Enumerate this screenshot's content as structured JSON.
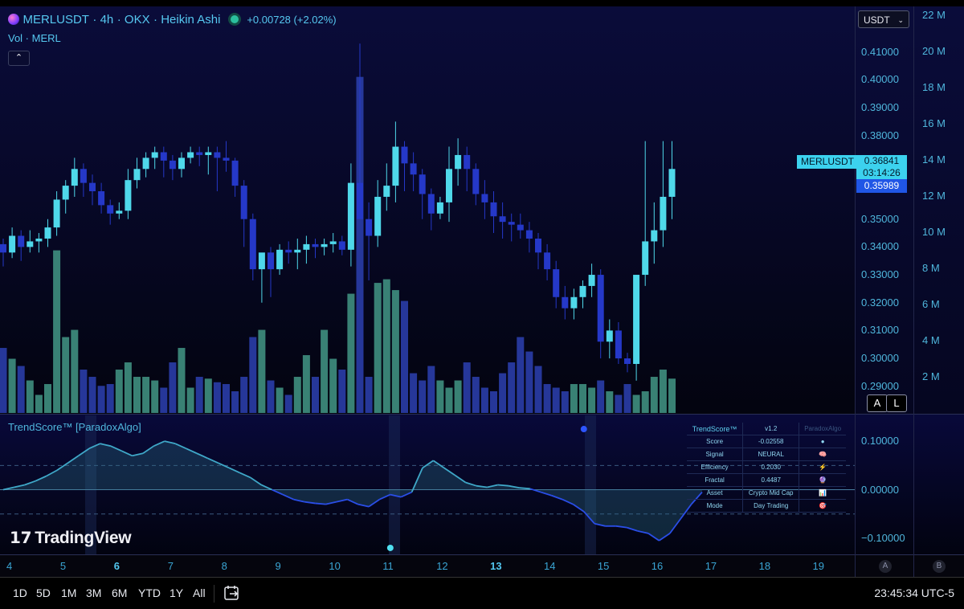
{
  "header": {
    "symbol": "MERLUSDT",
    "interval": "4h",
    "exchange": "OKX",
    "chart_style": "Heikin Ashi",
    "change": "+0.00728 (+2.02%)",
    "volume_label": "Vol · MERL",
    "currency": "USDT"
  },
  "price_axis": {
    "labels": [
      "0.41000",
      "0.40000",
      "0.39000",
      "0.38000",
      "0.35000",
      "0.34000",
      "0.33000",
      "0.32000",
      "0.31000",
      "0.30000",
      "0.29000"
    ],
    "current_symbol": "MERLUSDT",
    "current_price": "0.36841",
    "countdown": "03:14:26",
    "secondary_price": "0.35989",
    "auto_btn": "A",
    "log_btn": "L"
  },
  "volume_axis": {
    "labels": [
      "22 M",
      "20 M",
      "18 M",
      "16 M",
      "14 M",
      "12 M",
      "10 M",
      "8 M",
      "6 M",
      "4 M",
      "2 M"
    ]
  },
  "indicator": {
    "title": "TrendScore™ [ParadoxAlgo]",
    "axis_labels": [
      "0.10000",
      "0.00000",
      "−0.10000"
    ],
    "table": {
      "header": [
        "TrendScore™",
        "v1.2",
        "ParadoxAlgo"
      ],
      "rows": [
        {
          "label": "Score",
          "value": "-0.02558",
          "icon": "●"
        },
        {
          "label": "Signal",
          "value": "NEURAL",
          "icon": "🧠"
        },
        {
          "label": "Efficiency",
          "value": "0.2030",
          "icon": "⚡"
        },
        {
          "label": "Fractal",
          "value": "0.4487",
          "icon": "🔮"
        },
        {
          "label": "Asset",
          "value": "Crypto Mid Cap",
          "icon": "📊"
        },
        {
          "label": "Mode",
          "value": "Day Trading",
          "icon": "🎯"
        }
      ]
    }
  },
  "time_axis": {
    "labels": [
      "4",
      "5",
      "6",
      "7",
      "8",
      "9",
      "10",
      "11",
      "12",
      "13",
      "14",
      "15",
      "16",
      "17",
      "18",
      "19"
    ],
    "scale_a": "A",
    "scale_b": "B"
  },
  "brand": "TradingView",
  "bottom_bar": {
    "ranges": [
      "1D",
      "5D",
      "1M",
      "3M",
      "6M",
      "YTD",
      "1Y",
      "All"
    ],
    "clock": "23:45:34 UTC-5"
  },
  "colors": {
    "bull": "#4fd8ea",
    "bear": "#2538c8",
    "vol_bull": "#3f8f7f",
    "vol_bear": "#2a3da8",
    "text_accent": "#4fc3e8"
  },
  "chart_data": {
    "type": "candlestick",
    "style": "Heikin Ashi",
    "x_tick_labels": [
      "4",
      "5",
      "6",
      "7",
      "8",
      "9",
      "10",
      "11",
      "12",
      "13",
      "14",
      "15",
      "16",
      "17",
      "18",
      "19"
    ],
    "price_range": [
      0.283,
      0.42
    ],
    "volume_range_millions": [
      0,
      22.5
    ],
    "candles": [
      [
        0.341,
        0.343,
        0.333,
        0.338
      ],
      [
        0.338,
        0.347,
        0.336,
        0.344
      ],
      [
        0.344,
        0.346,
        0.335,
        0.34
      ],
      [
        0.34,
        0.346,
        0.338,
        0.342
      ],
      [
        0.342,
        0.345,
        0.338,
        0.343
      ],
      [
        0.343,
        0.35,
        0.34,
        0.347
      ],
      [
        0.347,
        0.36,
        0.344,
        0.357
      ],
      [
        0.357,
        0.364,
        0.352,
        0.362
      ],
      [
        0.362,
        0.372,
        0.358,
        0.368
      ],
      [
        0.368,
        0.37,
        0.358,
        0.363
      ],
      [
        0.363,
        0.366,
        0.355,
        0.36
      ],
      [
        0.36,
        0.363,
        0.352,
        0.355
      ],
      [
        0.355,
        0.357,
        0.348,
        0.352
      ],
      [
        0.352,
        0.356,
        0.35,
        0.353
      ],
      [
        0.353,
        0.368,
        0.35,
        0.364
      ],
      [
        0.364,
        0.372,
        0.361,
        0.368
      ],
      [
        0.368,
        0.374,
        0.365,
        0.372
      ],
      [
        0.372,
        0.376,
        0.368,
        0.374
      ],
      [
        0.374,
        0.376,
        0.365,
        0.371
      ],
      [
        0.371,
        0.373,
        0.364,
        0.368
      ],
      [
        0.368,
        0.374,
        0.365,
        0.372
      ],
      [
        0.372,
        0.376,
        0.37,
        0.374
      ],
      [
        0.374,
        0.376,
        0.369,
        0.373
      ],
      [
        0.373,
        0.376,
        0.366,
        0.374
      ],
      [
        0.374,
        0.376,
        0.36,
        0.372
      ],
      [
        0.372,
        0.378,
        0.367,
        0.371
      ],
      [
        0.371,
        0.372,
        0.358,
        0.362
      ],
      [
        0.362,
        0.364,
        0.34,
        0.35
      ],
      [
        0.35,
        0.352,
        0.328,
        0.332
      ],
      [
        0.332,
        0.334,
        0.32,
        0.338
      ],
      [
        0.338,
        0.34,
        0.322,
        0.332
      ],
      [
        0.332,
        0.341,
        0.33,
        0.339
      ],
      [
        0.339,
        0.342,
        0.334,
        0.338
      ],
      [
        0.338,
        0.343,
        0.332,
        0.339
      ],
      [
        0.339,
        0.344,
        0.334,
        0.341
      ],
      [
        0.341,
        0.343,
        0.336,
        0.34
      ],
      [
        0.34,
        0.343,
        0.337,
        0.341
      ],
      [
        0.341,
        0.345,
        0.338,
        0.342
      ],
      [
        0.342,
        0.344,
        0.337,
        0.339
      ],
      [
        0.339,
        0.37,
        0.333,
        0.363
      ],
      [
        0.363,
        0.413,
        0.353,
        0.35
      ],
      [
        0.35,
        0.356,
        0.328,
        0.344
      ],
      [
        0.344,
        0.364,
        0.34,
        0.358
      ],
      [
        0.358,
        0.37,
        0.353,
        0.362
      ],
      [
        0.362,
        0.385,
        0.356,
        0.376
      ],
      [
        0.376,
        0.378,
        0.36,
        0.37
      ],
      [
        0.37,
        0.374,
        0.36,
        0.366
      ],
      [
        0.366,
        0.368,
        0.35,
        0.359
      ],
      [
        0.359,
        0.361,
        0.346,
        0.352
      ],
      [
        0.352,
        0.358,
        0.35,
        0.356
      ],
      [
        0.356,
        0.376,
        0.349,
        0.368
      ],
      [
        0.368,
        0.379,
        0.362,
        0.373
      ],
      [
        0.373,
        0.376,
        0.36,
        0.368
      ],
      [
        0.368,
        0.37,
        0.355,
        0.359
      ],
      [
        0.359,
        0.364,
        0.35,
        0.356
      ],
      [
        0.356,
        0.36,
        0.345,
        0.351
      ],
      [
        0.351,
        0.356,
        0.343,
        0.349
      ],
      [
        0.349,
        0.352,
        0.342,
        0.348
      ],
      [
        0.348,
        0.352,
        0.343,
        0.346
      ],
      [
        0.346,
        0.349,
        0.338,
        0.343
      ],
      [
        0.343,
        0.345,
        0.332,
        0.338
      ],
      [
        0.338,
        0.341,
        0.328,
        0.332
      ],
      [
        0.332,
        0.335,
        0.318,
        0.322
      ],
      [
        0.322,
        0.326,
        0.314,
        0.318
      ],
      [
        0.318,
        0.325,
        0.314,
        0.322
      ],
      [
        0.322,
        0.328,
        0.318,
        0.326
      ],
      [
        0.326,
        0.334,
        0.322,
        0.33
      ],
      [
        0.33,
        0.332,
        0.3,
        0.306
      ],
      [
        0.306,
        0.314,
        0.3,
        0.31
      ],
      [
        0.31,
        0.313,
        0.298,
        0.3
      ],
      [
        0.3,
        0.302,
        0.295,
        0.298
      ],
      [
        0.298,
        0.33,
        0.292,
        0.33
      ],
      [
        0.33,
        0.378,
        0.326,
        0.342
      ],
      [
        0.342,
        0.356,
        0.334,
        0.346
      ],
      [
        0.346,
        0.378,
        0.34,
        0.358
      ],
      [
        0.358,
        0.378,
        0.35,
        0.368
      ]
    ],
    "volume_millions": [
      3.6,
      3.0,
      2.6,
      1.8,
      1.0,
      1.6,
      9.0,
      4.2,
      4.6,
      2.4,
      2.0,
      1.5,
      1.6,
      2.4,
      2.8,
      2.0,
      2.0,
      1.8,
      1.4,
      2.8,
      3.6,
      1.4,
      2.0,
      1.9,
      1.7,
      1.6,
      1.2,
      2.0,
      4.2,
      4.6,
      1.8,
      1.4,
      1.0,
      2.0,
      3.2,
      2.0,
      4.6,
      3.0,
      2.4,
      6.6,
      18.6,
      2.0,
      7.2,
      7.4,
      6.8,
      6.2,
      2.2,
      1.8,
      2.6,
      1.8,
      1.4,
      1.8,
      2.8,
      2.0,
      1.4,
      1.2,
      2.2,
      2.8,
      4.2,
      3.4,
      2.6,
      1.6,
      1.4,
      1.2,
      1.6,
      1.6,
      1.4,
      1.8,
      1.2,
      1.0,
      1.6,
      1.0,
      1.2,
      2.0,
      2.4,
      1.9
    ]
  },
  "indicator_chart_data": {
    "type": "area",
    "y_range": [
      -0.125,
      0.14
    ],
    "values": [
      0,
      0.005,
      0.01,
      0.018,
      0.028,
      0.04,
      0.055,
      0.07,
      0.085,
      0.095,
      0.09,
      0.08,
      0.07,
      0.075,
      0.09,
      0.1,
      0.095,
      0.085,
      0.075,
      0.065,
      0.055,
      0.045,
      0.035,
      0.025,
      0.01,
      0,
      -0.01,
      -0.02,
      -0.025,
      -0.028,
      -0.03,
      -0.025,
      -0.02,
      -0.03,
      -0.035,
      -0.02,
      -0.01,
      -0.015,
      -0.005,
      0.045,
      0.06,
      0.045,
      0.03,
      0.015,
      0.008,
      0.005,
      0.01,
      0.008,
      0.004,
      0.002,
      -0.005,
      -0.012,
      -0.02,
      -0.03,
      -0.045,
      -0.07,
      -0.075,
      -0.075,
      -0.078,
      -0.085,
      -0.09,
      -0.105,
      -0.09,
      -0.06,
      -0.03,
      -0.005
    ],
    "dots": [
      {
        "i": 54,
        "v": 0.125,
        "color": "#2d55ff"
      },
      {
        "i": 36,
        "v": -0.12,
        "color": "#4fe0f0"
      }
    ]
  }
}
